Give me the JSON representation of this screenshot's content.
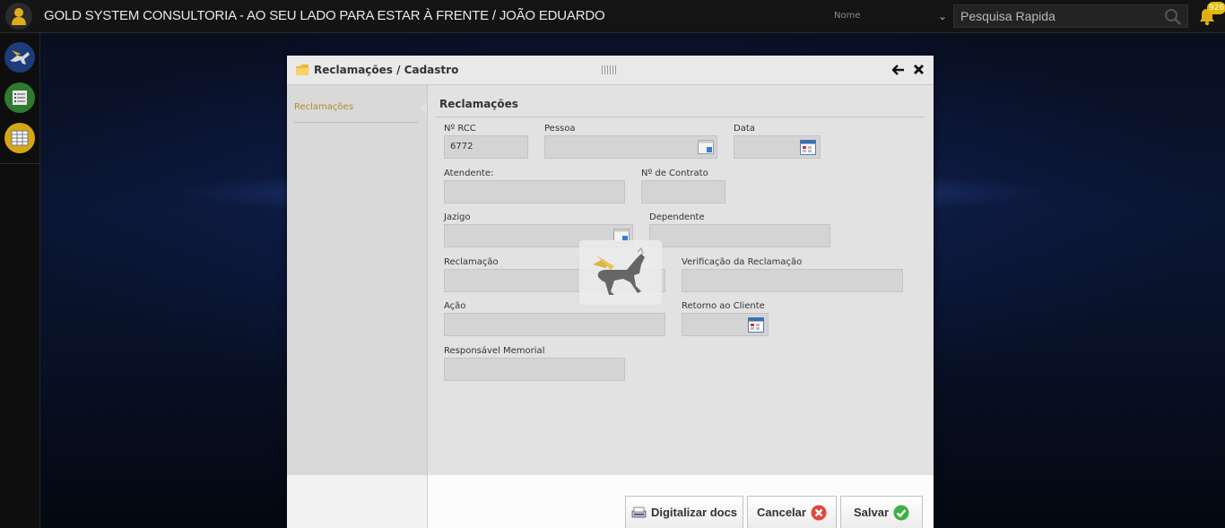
{
  "app": {
    "title": "GOLD SYSTEM CONSULTORIA - AO SEU LADO PARA ESTAR À FRENTE / JOÃO EDUARDO",
    "name_select": "Nome",
    "search_placeholder": "Pesquisa Rapida",
    "notification_count": "926"
  },
  "modal": {
    "title": "Reclamações / Cadastro",
    "nav_item": "Reclamações",
    "section_title": "Reclamações"
  },
  "form": {
    "rcc_label": "Nº RCC",
    "rcc_value": "6772",
    "pessoa_label": "Pessoa",
    "data_label": "Data",
    "atendente_label": "Atendente:",
    "contrato_label": "Nº de Contrato",
    "jazigo_label": "Jazigo",
    "dependente_label": "Dependente",
    "reclamacao_label": "Reclamação",
    "verificacao_label": "Verificação da Reclamação",
    "acao_label": "Ação",
    "retorno_label": "Retorno ao Cliente",
    "responsavel_label": "Responsável Memorial"
  },
  "buttons": {
    "digitalizar": "Digitalizar docs",
    "cancelar": "Cancelar",
    "salvar": "Salvar"
  },
  "colors": {
    "accent_gold": "#b08a2a",
    "cancel_red": "#e0473a",
    "save_green": "#3cb043"
  },
  "icons": {
    "user": "user-icon",
    "search": "search-icon",
    "bell": "bell-icon",
    "folder": "folder-icon",
    "back": "arrow-left-icon",
    "close": "close-icon",
    "calendar": "calendar-icon",
    "loader": "pegasus-loading-icon"
  }
}
